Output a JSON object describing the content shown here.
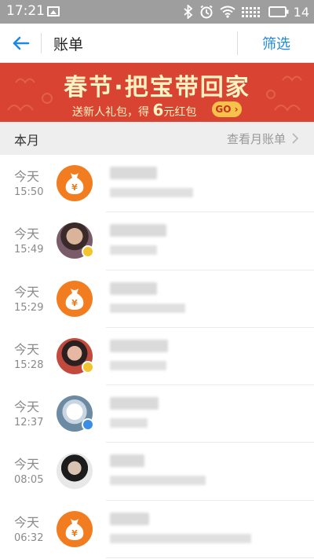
{
  "status_bar": {
    "time": "17:21",
    "battery": "14",
    "icons": [
      "image-icon",
      "bluetooth-icon",
      "alarm-icon",
      "wifi-icon",
      "signal-icon",
      "battery-icon"
    ]
  },
  "header": {
    "title": "账单",
    "filter_label": "筛选"
  },
  "banner": {
    "title": "春节·把宝带回家",
    "sub_prefix": "送新人礼包，得",
    "sub_amount": "6",
    "sub_suffix": "元红包",
    "go_label": "GO"
  },
  "month_bar": {
    "label": "本月",
    "link": "查看月账单"
  },
  "colors": {
    "accent": "#1e88e5",
    "banner_red": "#d84431",
    "banner_text": "#fff3c4",
    "bag_orange": "#f27d20"
  },
  "transactions": [
    {
      "day": "今天",
      "time": "15:50",
      "avatar": "money-bag-icon"
    },
    {
      "day": "今天",
      "time": "15:49",
      "avatar": "user-photo",
      "badge": "star-badge-icon"
    },
    {
      "day": "今天",
      "time": "15:29",
      "avatar": "money-bag-icon"
    },
    {
      "day": "今天",
      "time": "15:28",
      "avatar": "user-photo",
      "badge": "star-badge-icon"
    },
    {
      "day": "今天",
      "time": "12:37",
      "avatar": "user-photo",
      "badge": "verified-badge-icon"
    },
    {
      "day": "今天",
      "time": "08:05",
      "avatar": "user-photo"
    },
    {
      "day": "今天",
      "time": "06:32",
      "avatar": "money-bag-icon"
    }
  ]
}
